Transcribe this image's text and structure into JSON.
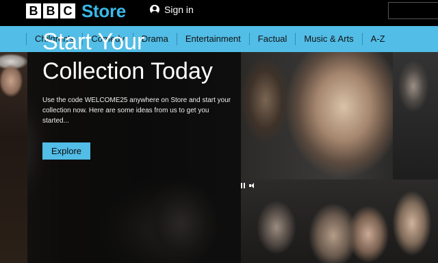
{
  "header": {
    "logo_letters": [
      "B",
      "B",
      "C"
    ],
    "logo_store": "Store",
    "signin_label": "Sign in"
  },
  "nav": {
    "items": [
      "Children's",
      "Comedy",
      "Drama",
      "Entertainment",
      "Factual",
      "Music & Arts",
      "A-Z"
    ]
  },
  "hero": {
    "title_line1": "Start Your",
    "title_line2": "Collection Today",
    "body": "Use the code WELCOME25 anywhere on Store and start your collection now. Here are some ideas from us to get you started...",
    "cta_label": "Explore"
  },
  "colors": {
    "accent": "#52bde6",
    "logo_store": "#3ab8e6",
    "header_bg": "#000000"
  }
}
